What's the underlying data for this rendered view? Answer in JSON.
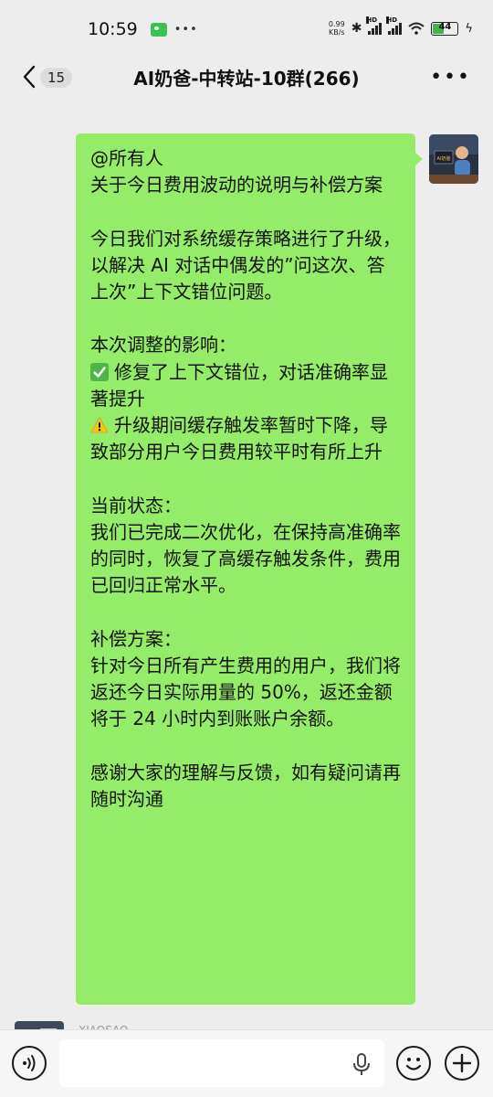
{
  "status_bar": {
    "time": "10:59",
    "net_speed_value": "0.99",
    "net_speed_unit": "KB/s",
    "signal_label_1": "HD",
    "signal_label_2": "HD",
    "battery_level": "44",
    "battery_fraction": 0.44
  },
  "nav": {
    "unread_count": "15",
    "title": "AI奶爸-中转站-10群(266)"
  },
  "avatar": {
    "label": "AI奶爸"
  },
  "message": {
    "lines": [
      "@所有人",
      "关于今日费用波动的说明与补偿方案",
      "",
      "今日我们对系统缓存策略进行了升级，以解决 AI 对话中偶发的”问这次、答上次”上下文错位问题。",
      "",
      "本次调整的影响：",
      "修复了上下文错位，对话准确率显著提升",
      "升级期间缓存触发率暂时下降，导致部分用户今日费用较平时有所上升",
      "",
      "当前状态：",
      "我们已完成二次优化，在保持高准确率的同时，恢复了高缓存触发条件，费用已回归正常水平。",
      "",
      "补偿方案：",
      "针对今日所有产生费用的用户，我们将返还今日实际用量的 50%，返还金额将于 24 小时内到账账户余额。",
      "",
      "感谢大家的理解与反馈，如有疑问请再随时沟通"
    ],
    "check_icon": "check-mark-button-icon",
    "warning_icon": "warning-icon"
  },
  "next_message": {
    "sender_partial": "XIAOSAO"
  },
  "input_bar": {
    "placeholder": ""
  },
  "colors": {
    "bubble": "#95ec69",
    "background": "#ededed",
    "check_green": "#4cb648",
    "warning_yellow": "#f5c518"
  }
}
